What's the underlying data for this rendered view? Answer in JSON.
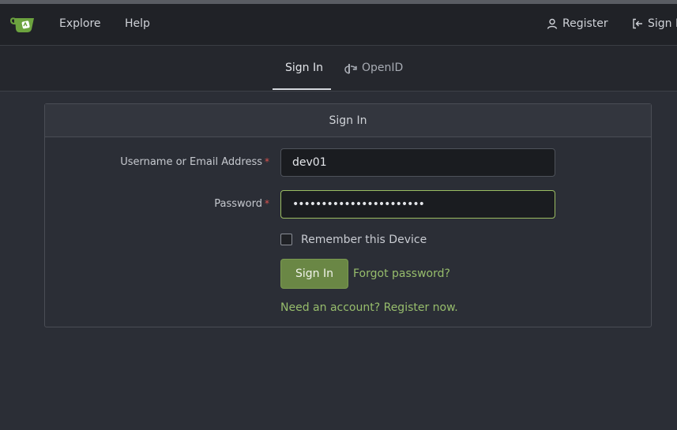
{
  "navbar": {
    "logo_icon": "gitea-teacup-icon",
    "links": [
      "Explore",
      "Help"
    ],
    "register_label": "Register",
    "signin_label": "Sign In"
  },
  "tabs": [
    {
      "label": "Sign In",
      "active": true
    },
    {
      "label": "OpenID",
      "active": false,
      "icon": "openid-icon"
    }
  ],
  "form": {
    "title": "Sign In",
    "username_label": "Username or Email Address",
    "username_value": "dev01",
    "password_label": "Password",
    "password_value": "•••••••••••••••••••••••",
    "required_marker": "*",
    "remember_label": "Remember this Device",
    "remember_checked": false,
    "submit_label": "Sign In",
    "forgot_label": "Forgot password?",
    "register_link": "Need an account? Register now."
  },
  "colors": {
    "accent": "#6a8745",
    "link": "#97bd6c",
    "required": "#d9534f",
    "background": "#2b2e36"
  }
}
